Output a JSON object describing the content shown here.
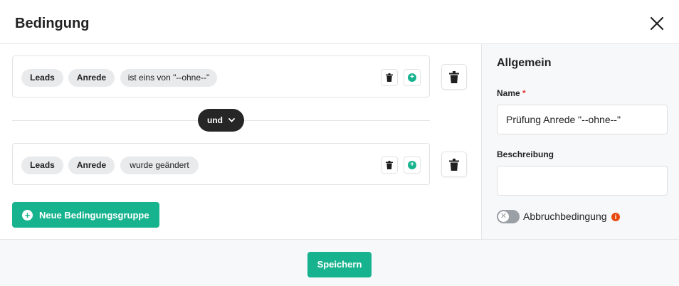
{
  "dialog": {
    "title": "Bedingung",
    "close_icon": "close-icon"
  },
  "conditions": [
    {
      "entity": "Leads",
      "field": "Anrede",
      "operator": "ist eins von \"--ohne--\""
    },
    {
      "entity": "Leads",
      "field": "Anrede",
      "operator": "wurde geändert"
    }
  ],
  "connector": {
    "label": "und",
    "icon": "chevron-down-icon"
  },
  "new_group_button": {
    "label": "Neue Bedingungsgruppe",
    "icon": "plus-circle-icon"
  },
  "sidebar": {
    "title": "Allgemein",
    "name_label": "Name",
    "required_marker": "*",
    "name_value": "Prüfung Anrede \"--ohne--\"",
    "description_label": "Beschreibung",
    "description_value": "",
    "abort_label": "Abbruchbedingung",
    "abort_enabled": false,
    "info_icon": "info-icon"
  },
  "footer": {
    "save_label": "Speichern"
  },
  "colors": {
    "accent": "#17b38e",
    "dark_pill": "#262626",
    "required": "#e53935",
    "info": "#e8490f"
  }
}
